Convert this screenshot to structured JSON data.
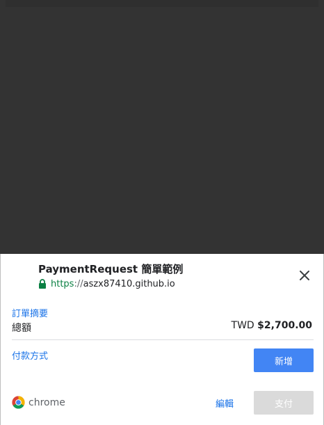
{
  "sheet": {
    "title": "PaymentRequest 簡單範例",
    "url": {
      "scheme": "https",
      "separator": "://",
      "host": "aszx87410.github.io"
    },
    "close_icon": "close-icon",
    "lock_icon": "lock-icon"
  },
  "summary": {
    "label": "訂單摘要",
    "total_label": "總額",
    "currency": "TWD",
    "amount": "$2,700.00"
  },
  "payment": {
    "label": "付款方式",
    "add_button": "新增"
  },
  "footer": {
    "brand": "chrome",
    "edit_button": "編輯",
    "pay_button": "支付"
  },
  "colors": {
    "overlay": "#333333",
    "link": "#1a73e8",
    "primary_button": "#4285f4",
    "disabled_button": "#dadada",
    "secure_green": "#0b8043"
  }
}
